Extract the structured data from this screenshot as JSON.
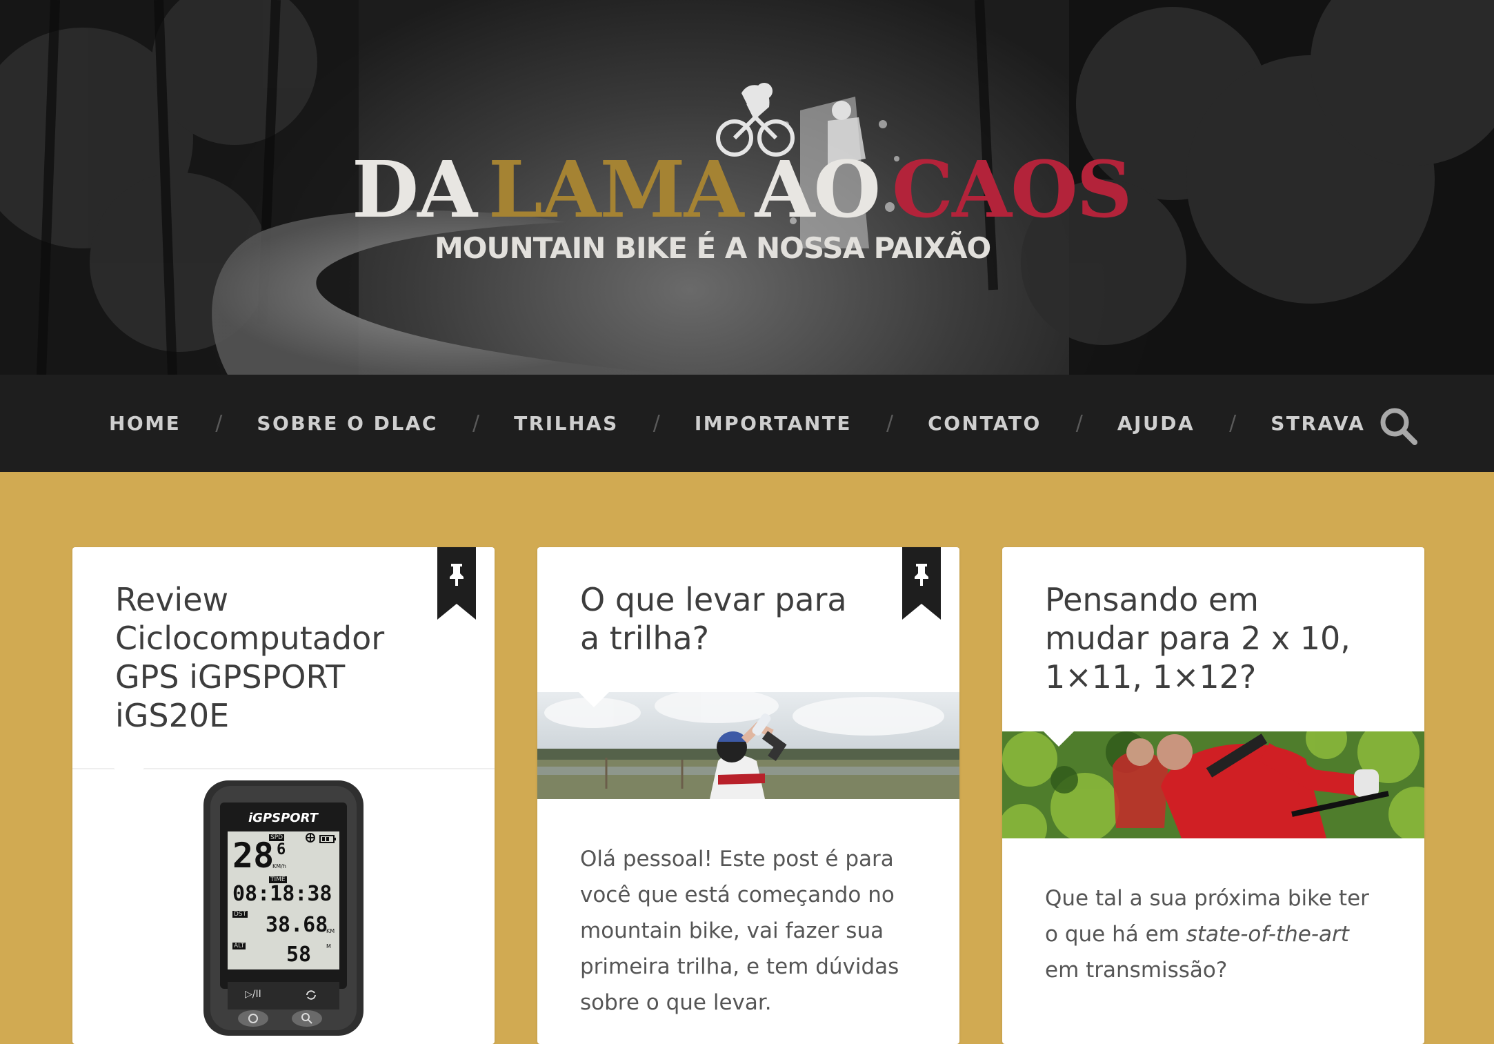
{
  "site": {
    "logo_words": [
      "DA",
      "LAMA",
      "AO",
      "CAOS"
    ],
    "tagline": "MOUNTAIN BIKE É A NOSSA PAIXÃO",
    "colors": {
      "gold": "#a58333",
      "red": "#b3233a",
      "nav_bg": "#1e1e1e",
      "page_bg": "#d1aa52"
    }
  },
  "nav": {
    "items": [
      "HOME",
      "SOBRE O DLAC",
      "TRILHAS",
      "IMPORTANTE",
      "CONTATO",
      "AJUDA",
      "STRAVA"
    ],
    "separator": "/",
    "search_icon": "search-icon"
  },
  "posts": [
    {
      "title": "Review Ciclocomputador GPS iGPSPORT iGS20E",
      "pinned": true,
      "device": {
        "brand": "iGPSPORT",
        "spd_label": "SPD",
        "speed": "28",
        "speed_dec": "6",
        "speed_unit": "KM/h",
        "time_label": "TIME",
        "time": "08:18:38",
        "dst_label": "DST",
        "distance": "38.68",
        "distance_unit": "KM",
        "alt_label": "ALT",
        "altitude": "58",
        "altitude_unit": "M",
        "play_label": "▷/II"
      }
    },
    {
      "title": "O que levar para a trilha?",
      "pinned": true,
      "excerpt": "Olá pessoal! Este post é para você que está começando no mountain bike, vai fazer sua primeira trilha, e tem dúvidas sobre o que levar."
    },
    {
      "title": "Pensando em mudar para 2 x 10, 1×11, 1×12?",
      "pinned": false,
      "excerpt_before": "Que tal a sua próxima bike ter o que há em ",
      "excerpt_italic": "state-of-the-art",
      "excerpt_after": " em transmissão?"
    }
  ]
}
